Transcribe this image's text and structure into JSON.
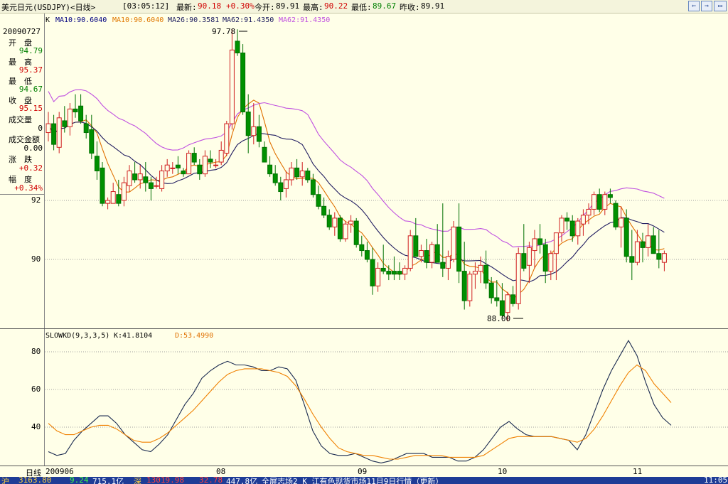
{
  "header": {
    "title": "美元日元(USDJPY)<日线>",
    "time": "[03:05:12]",
    "latest_label": "最新:",
    "latest_value": "90.18",
    "change_pct": "+0.30%",
    "open_label": "今开:",
    "open_value": "89.91",
    "high_label": "最高:",
    "high_value": "90.22",
    "low_label": "最低:",
    "low_value": "89.67",
    "prev_label": "昨收:",
    "prev_value": "89.91"
  },
  "legend": {
    "k": "K",
    "ma1": "MA10:90.6040",
    "ma2": "MA10:90.6040",
    "ma3": "MA26:90.3581",
    "ma4": "MA62:91.4350",
    "ma5": "MA62:91.4350",
    "colors": {
      "ma1": "#000080",
      "ma2": "#E07800",
      "ma3": "#202060",
      "ma4": "#202060",
      "ma5": "#C050E0"
    }
  },
  "info_panel": {
    "date": "20090727",
    "open_label": "开　盘",
    "open_value": "94.79",
    "high_label": "最　高",
    "high_value": "95.37",
    "low_label": "最　低",
    "low_value": "94.67",
    "close_label": "收　盘",
    "close_value": "95.15",
    "volume_label": "成交量",
    "volume_value": "0",
    "amount_label": "成交金额",
    "amount_value": "0.00",
    "change_label": "涨　跌",
    "change_value": "+0.32",
    "range_label": "幅　度",
    "range_value": "+0.34%"
  },
  "price_axis": {
    "labels": [
      "92",
      "90"
    ]
  },
  "annotations": {
    "high": "97.78",
    "low": "88.00"
  },
  "indicator": {
    "label": "SLOWKD(9,3,3,5)",
    "k_label": "K:41.8104",
    "d_label": "D:53.4990",
    "axis_labels": [
      "80",
      "60",
      "40"
    ],
    "k_color": "#1A2A50",
    "d_color": "#F08000"
  },
  "dates": {
    "period_label": "日线",
    "ticks": [
      "200906",
      "08",
      "09",
      "10",
      "11"
    ]
  },
  "ticker": {
    "a": "沪",
    "b": "3163.80",
    "c": "9.24",
    "d": "715.1亿",
    "e": "深",
    "f": "13019.98",
    "g": "32.78",
    "h": "447.8亿",
    "news": "全屏志场2 K 江有色现货市场11月9日行情（更新）",
    "clock": "11:05"
  },
  "chart_data": {
    "type": "candlestick",
    "price_range": [
      87.6,
      98.5
    ],
    "series_candles": [
      [
        94.3,
        95.0,
        94.0,
        94.6
      ],
      [
        94.6,
        94.9,
        93.7,
        93.9
      ],
      [
        93.8,
        95.0,
        93.6,
        94.8
      ],
      [
        94.7,
        95.2,
        94.3,
        94.5
      ],
      [
        94.5,
        95.3,
        94.2,
        95.1
      ],
      [
        95.1,
        95.6,
        94.8,
        95.0
      ],
      [
        95.2,
        95.6,
        94.6,
        94.7
      ],
      [
        94.6,
        94.9,
        94.1,
        94.3
      ],
      [
        94.4,
        94.9,
        93.4,
        93.6
      ],
      [
        93.5,
        94.0,
        92.7,
        93.0
      ],
      [
        93.1,
        93.3,
        91.8,
        91.9
      ],
      [
        91.9,
        92.1,
        91.7,
        92.0
      ],
      [
        91.9,
        92.6,
        91.9,
        92.3
      ],
      [
        92.2,
        92.7,
        91.8,
        91.9
      ],
      [
        92.0,
        92.8,
        91.8,
        92.6
      ],
      [
        92.5,
        93.2,
        92.3,
        93.0
      ],
      [
        92.9,
        93.3,
        92.6,
        92.7
      ],
      [
        92.7,
        93.2,
        92.4,
        92.9
      ],
      [
        92.8,
        93.3,
        92.3,
        92.6
      ],
      [
        92.6,
        92.8,
        92.0,
        92.4
      ],
      [
        92.5,
        92.8,
        92.4,
        92.5
      ],
      [
        92.4,
        93.2,
        92.3,
        93.0
      ],
      [
        93.0,
        93.4,
        92.8,
        93.2
      ],
      [
        93.1,
        93.3,
        92.9,
        93.1
      ],
      [
        93.2,
        93.5,
        92.9,
        93.1
      ],
      [
        93.0,
        93.1,
        92.8,
        92.9
      ],
      [
        92.9,
        93.7,
        92.9,
        93.6
      ],
      [
        93.6,
        93.8,
        93.2,
        93.3
      ],
      [
        93.2,
        93.4,
        92.7,
        92.9
      ],
      [
        92.9,
        93.7,
        92.8,
        93.5
      ],
      [
        93.4,
        93.7,
        93.1,
        93.3
      ],
      [
        93.2,
        93.4,
        93.1,
        93.2
      ],
      [
        93.3,
        94.0,
        93.2,
        93.7
      ],
      [
        93.6,
        94.7,
        93.5,
        94.6
      ],
      [
        94.6,
        97.8,
        94.4,
        97.1
      ],
      [
        97.4,
        97.8,
        96.9,
        97.0
      ],
      [
        97.0,
        97.3,
        94.9,
        95.0
      ],
      [
        95.0,
        95.6,
        93.6,
        94.2
      ],
      [
        94.2,
        95.3,
        93.9,
        94.5
      ],
      [
        94.5,
        94.9,
        93.8,
        94.0
      ],
      [
        93.8,
        94.0,
        93.4,
        93.3
      ],
      [
        93.2,
        93.5,
        92.8,
        92.9
      ],
      [
        92.9,
        93.2,
        92.5,
        92.6
      ],
      [
        92.6,
        92.8,
        92.0,
        92.3
      ],
      [
        92.4,
        93.0,
        92.1,
        92.7
      ],
      [
        92.7,
        93.3,
        92.5,
        93.1
      ],
      [
        93.1,
        93.4,
        92.7,
        92.8
      ],
      [
        92.8,
        93.3,
        92.5,
        93.0
      ],
      [
        93.0,
        93.1,
        92.6,
        92.7
      ],
      [
        92.7,
        92.9,
        92.1,
        92.2
      ],
      [
        92.2,
        92.5,
        91.7,
        91.8
      ],
      [
        91.8,
        92.1,
        91.4,
        91.5
      ],
      [
        91.5,
        91.7,
        91.0,
        91.1
      ],
      [
        91.1,
        91.6,
        90.8,
        91.4
      ],
      [
        91.4,
        91.5,
        90.6,
        90.7
      ],
      [
        90.7,
        91.3,
        90.6,
        91.2
      ],
      [
        91.2,
        91.5,
        90.9,
        91.3
      ],
      [
        91.3,
        91.4,
        90.4,
        90.5
      ],
      [
        90.5,
        90.8,
        90.1,
        90.3
      ],
      [
        90.3,
        90.6,
        89.9,
        90.0
      ],
      [
        90.0,
        90.4,
        88.8,
        89.1
      ],
      [
        89.1,
        89.9,
        88.9,
        89.7
      ],
      [
        89.7,
        90.5,
        89.5,
        89.6
      ],
      [
        89.6,
        89.8,
        89.3,
        89.5
      ],
      [
        89.6,
        90.1,
        89.3,
        89.5
      ],
      [
        89.6,
        89.9,
        89.3,
        89.5
      ],
      [
        89.5,
        89.8,
        89.3,
        89.7
      ],
      [
        89.7,
        91.0,
        89.6,
        90.8
      ],
      [
        90.8,
        91.4,
        90.6,
        90.1
      ],
      [
        90.1,
        90.5,
        89.9,
        90.3
      ],
      [
        90.3,
        90.7,
        89.7,
        89.9
      ],
      [
        89.9,
        90.6,
        89.7,
        90.5
      ],
      [
        90.5,
        91.2,
        90.3,
        89.9
      ],
      [
        89.9,
        91.9,
        89.4,
        89.7
      ],
      [
        89.7,
        90.3,
        89.3,
        90.1
      ],
      [
        90.0,
        91.3,
        89.9,
        91.1
      ],
      [
        91.1,
        91.9,
        89.2,
        89.6
      ],
      [
        89.6,
        90.6,
        88.3,
        88.6
      ],
      [
        88.6,
        89.6,
        88.4,
        89.5
      ],
      [
        89.5,
        89.9,
        89.0,
        89.6
      ],
      [
        89.6,
        90.1,
        89.2,
        89.8
      ],
      [
        89.8,
        90.3,
        89.0,
        89.2
      ],
      [
        89.2,
        89.4,
        88.5,
        88.7
      ],
      [
        88.7,
        89.3,
        88.4,
        88.6
      ],
      [
        88.6,
        89.2,
        88.0,
        88.1
      ],
      [
        88.2,
        88.9,
        87.9,
        88.8
      ],
      [
        88.8,
        89.1,
        88.4,
        88.5
      ],
      [
        88.5,
        90.4,
        88.3,
        90.2
      ],
      [
        90.2,
        91.2,
        89.6,
        89.7
      ],
      [
        89.8,
        90.6,
        89.2,
        90.4
      ],
      [
        90.3,
        91.0,
        89.7,
        90.7
      ],
      [
        90.7,
        91.2,
        90.2,
        90.5
      ],
      [
        90.5,
        90.7,
        89.2,
        89.6
      ],
      [
        89.6,
        90.3,
        89.3,
        90.2
      ],
      [
        90.2,
        90.8,
        89.3,
        90.9
      ],
      [
        90.9,
        91.5,
        90.6,
        91.4
      ],
      [
        91.4,
        91.6,
        91.0,
        91.3
      ],
      [
        91.3,
        91.5,
        90.6,
        90.8
      ],
      [
        90.8,
        91.4,
        90.5,
        91.3
      ],
      [
        91.2,
        91.7,
        90.8,
        91.5
      ],
      [
        91.5,
        91.9,
        91.2,
        91.7
      ],
      [
        91.7,
        92.3,
        91.5,
        92.2
      ],
      [
        92.2,
        92.4,
        91.6,
        91.7
      ],
      [
        91.7,
        92.3,
        91.5,
        92.2
      ],
      [
        92.2,
        92.4,
        91.9,
        92.1
      ],
      [
        91.9,
        92.0,
        91.0,
        91.1
      ],
      [
        91.1,
        91.8,
        90.4,
        91.4
      ],
      [
        91.4,
        91.7,
        89.9,
        90.1
      ],
      [
        90.1,
        91.0,
        89.3,
        89.9
      ],
      [
        89.9,
        91.0,
        89.8,
        90.6
      ],
      [
        90.6,
        90.9,
        89.9,
        90.4
      ],
      [
        90.4,
        91.2,
        90.1,
        90.8
      ],
      [
        90.8,
        91.1,
        90.3,
        90.2
      ],
      [
        90.2,
        91.0,
        89.7,
        90.0
      ],
      [
        89.9,
        90.3,
        89.6,
        90.2
      ]
    ],
    "kd": {
      "k": [
        27,
        25,
        26,
        33,
        38,
        42,
        46,
        46,
        42,
        36,
        32,
        28,
        27,
        31,
        36,
        44,
        52,
        58,
        66,
        70,
        73,
        75,
        73,
        73,
        72,
        70,
        70,
        72,
        71,
        65,
        52,
        38,
        30,
        26,
        25,
        25,
        26,
        24,
        22,
        21,
        22,
        24,
        26,
        26,
        26,
        24,
        24,
        24,
        22,
        22,
        24,
        28,
        34,
        40,
        43,
        39,
        36,
        35,
        35,
        35,
        34,
        33,
        28,
        36,
        48,
        60,
        70,
        78,
        86,
        78,
        64,
        52,
        45,
        41
      ],
      "d": [
        42,
        38,
        36,
        36,
        38,
        40,
        41,
        41,
        39,
        36,
        33,
        32,
        32,
        34,
        37,
        41,
        45,
        49,
        54,
        59,
        64,
        68,
        70,
        71,
        71,
        71,
        70,
        69,
        67,
        62,
        55,
        47,
        40,
        34,
        29,
        27,
        26,
        25,
        25,
        24,
        23,
        23,
        24,
        25,
        25,
        25,
        25,
        24,
        24,
        24,
        24,
        25,
        28,
        31,
        34,
        35,
        35,
        35,
        35,
        35,
        34,
        33,
        32,
        34,
        39,
        46,
        54,
        62,
        69,
        73,
        70,
        63,
        58,
        53
      ]
    },
    "ma_fast_color": "#E07000",
    "ma_slow_color": "#201C60",
    "ma_long_color": "#C050E0"
  }
}
